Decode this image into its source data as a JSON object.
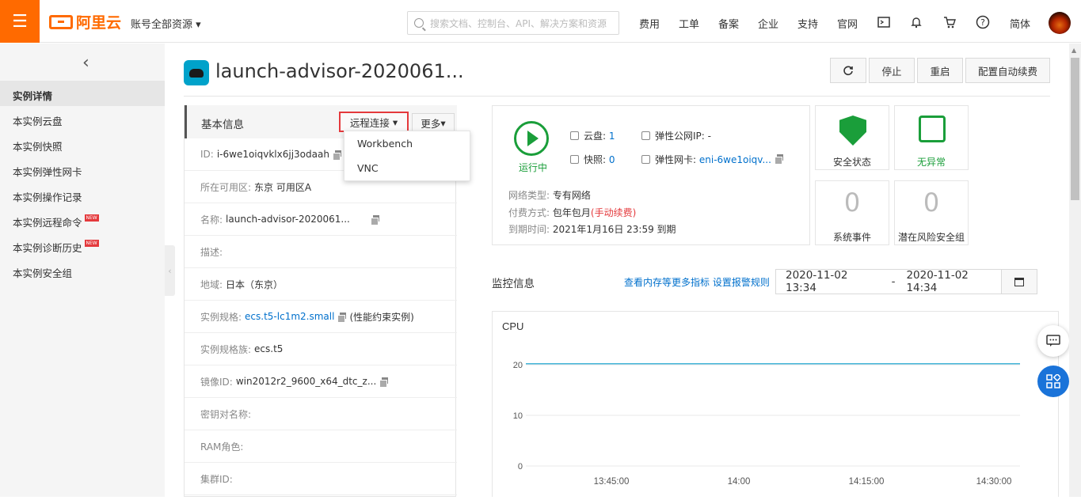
{
  "header": {
    "logo_text": "阿里云",
    "account_label": "账号全部资源",
    "search_placeholder": "搜索文档、控制台、API、解决方案和资源",
    "nav": [
      "费用",
      "工单",
      "备案",
      "企业",
      "支持",
      "官网"
    ],
    "lang": "简体"
  },
  "sidebar": {
    "items": [
      {
        "label": "实例详情",
        "new": false
      },
      {
        "label": "本实例云盘",
        "new": false
      },
      {
        "label": "本实例快照",
        "new": false
      },
      {
        "label": "本实例弹性网卡",
        "new": false
      },
      {
        "label": "本实例操作记录",
        "new": false
      },
      {
        "label": "本实例远程命令",
        "new": true
      },
      {
        "label": "本实例诊断历史",
        "new": true
      },
      {
        "label": "本实例安全组",
        "new": false
      }
    ],
    "new_tag": "NEW"
  },
  "page": {
    "title": "launch-advisor-2020061...",
    "buttons": {
      "stop": "停止",
      "restart": "重启",
      "auto_renew": "配置自动续费"
    }
  },
  "basic": {
    "title": "基本信息",
    "remote_label": "远程连接",
    "more_label": "更多",
    "rows": [
      {
        "label": "ID:",
        "value": "i-6we1oiqvklx6jj3odaah"
      },
      {
        "label": "所在可用区:",
        "value": "东京 可用区A"
      },
      {
        "label": "名称:",
        "value": "launch-advisor-2020061..."
      },
      {
        "label": "描述:",
        "value": ""
      },
      {
        "label": "地域:",
        "value": "日本（东京）"
      },
      {
        "label": "实例规格:",
        "value": "ecs.t5-lc1m2.small",
        "extra": "(性能约束实例)"
      },
      {
        "label": "实例规格族:",
        "value": "ecs.t5"
      },
      {
        "label": "镜像ID:",
        "value": "win2012r2_9600_x64_dtc_z..."
      },
      {
        "label": "密钥对名称:",
        "value": ""
      },
      {
        "label": "RAM角色:",
        "value": ""
      },
      {
        "label": "集群ID:",
        "value": ""
      }
    ]
  },
  "dropdown": {
    "items": [
      "Workbench",
      "VNC"
    ]
  },
  "status": {
    "running": "运行中",
    "disk_label": "云盘:",
    "disk_value": "1",
    "snapshot_label": "快照:",
    "snapshot_value": "0",
    "eip_label": "弹性公网IP:",
    "eip_value": "-",
    "eni_label": "弹性网卡:",
    "eni_value": "eni-6we1oiqv...",
    "net_label": "网络类型:",
    "net_value": "专有网络",
    "pay_label": "付费方式:",
    "pay_value": "包年包月",
    "pay_extra": "(手动续费)",
    "expire_label": "到期时间:",
    "expire_value": "2021年1月16日 23:59 到期"
  },
  "cards": {
    "security": "安全状态",
    "normal": "无异常",
    "events_count": "0",
    "events_label": "系统事件",
    "risk_count": "0",
    "risk_label": "潜在风险安全组"
  },
  "monitor": {
    "title": "监控信息",
    "links": "查看内存等更多指标 设置报警规则",
    "date_from": "2020-11-02 13:34",
    "date_sep": "-",
    "date_to": "2020-11-02 14:34"
  },
  "colors": {
    "accent": "#ff6a00",
    "link": "#0070cc",
    "ok": "#1a9e3a",
    "series": "#44b5d8"
  },
  "chart_data": {
    "type": "line",
    "title": "CPU",
    "x": [
      "13:45:00",
      "14:00",
      "14:15:00",
      "14:30:00"
    ],
    "yticks": [
      0,
      10,
      20
    ],
    "ylim": [
      0,
      25
    ],
    "series": [
      {
        "values": [
          20.2,
          20.2,
          20.2,
          20.2
        ]
      }
    ],
    "grid": true
  }
}
